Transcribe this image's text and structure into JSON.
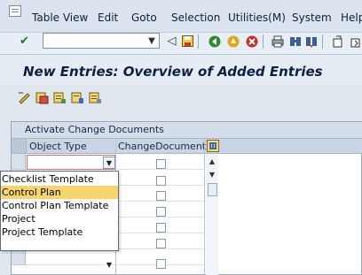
{
  "menu": [
    "Table View",
    "Edit",
    "Goto",
    "Selection",
    "Utilities(M)",
    "System",
    "Help"
  ],
  "toolbar": {
    "command_value": "",
    "icons": [
      "enter-icon",
      "back-icon",
      "save-icon",
      "back-green-icon",
      "exit-icon",
      "cancel-icon",
      "print-icon",
      "find-icon",
      "find-next-icon",
      "first-page-icon",
      "previous-page-icon"
    ]
  },
  "page_title": "New Entries: Overview of Added Entries",
  "app_toolbar_icons": [
    "edit-icon",
    "copy-entry-icon",
    "delete-icon",
    "select-all-icon"
  ],
  "table": {
    "title": "Activate Change Documents",
    "columns": [
      "Object Type",
      "ChangeDocuments"
    ],
    "rows": [
      {
        "object_type": "",
        "change_documents": false
      },
      {
        "object_type": "",
        "change_documents": false
      },
      {
        "object_type": "",
        "change_documents": false
      },
      {
        "object_type": "",
        "change_documents": false
      },
      {
        "object_type": "",
        "change_documents": false
      },
      {
        "object_type": "",
        "change_documents": false
      },
      {
        "object_type": "",
        "change_documents": false
      }
    ]
  },
  "dropdown": {
    "options": [
      "Checklist Template",
      "Control Plan",
      "Control Plan Template",
      "Project",
      "Project Template"
    ],
    "highlighted": "Control Plan"
  },
  "colors": {
    "accent_title": "#0c1f44",
    "highlight": "#f6d66c",
    "error_border": "#e46a6a"
  }
}
